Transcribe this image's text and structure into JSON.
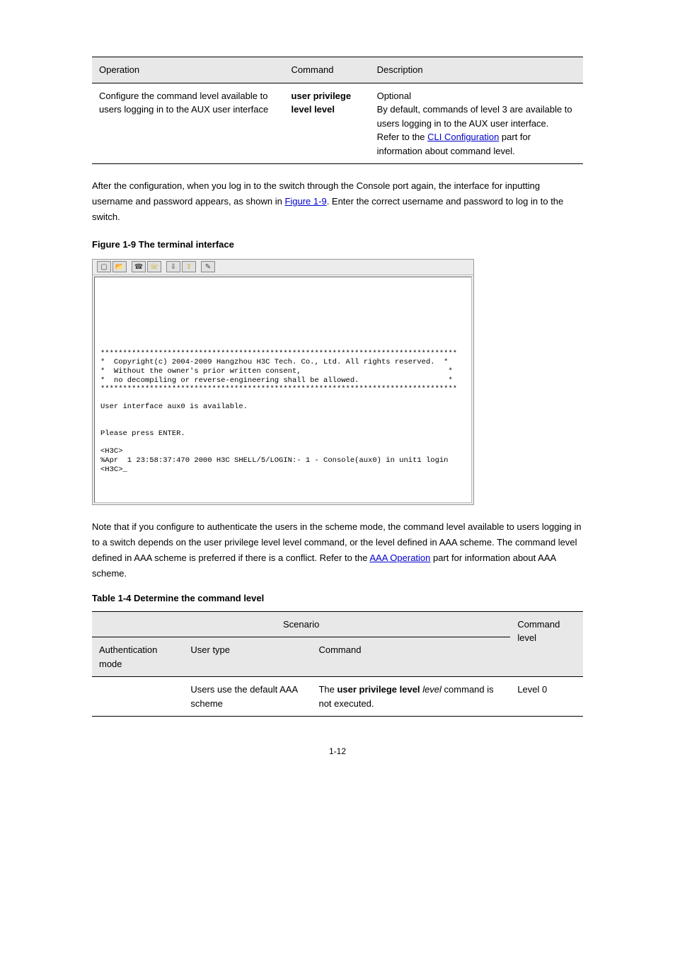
{
  "table4": {
    "headers": [
      "Operation",
      "Command",
      "Description"
    ],
    "rows": [
      {
        "operation": "Configure the command level available to users logging in to the AUX user interface",
        "command": "user privilege level level",
        "desc_prefix": "Optional\nBy default, commands of level 3 are available to users logging in to the AUX user interface.\nRefer to the ",
        "desc_link": "CLI Configuration",
        "desc_suffix": " part for information about command level."
      }
    ]
  },
  "para1_prefix": "After the configuration, when you log in to the switch through the Console port again, the interface for inputting username and password appears, as shown in ",
  "para1_link": "Figure 1-9",
  "para1_suffix": ". Enter the correct username and password to log in to the switch.",
  "fig_caption": "Figure 1-9 The terminal interface",
  "terminal": {
    "line_border": "********************************************************************************",
    "l1": "*  Copyright(c) 2004-2009 Hangzhou H3C Tech. Co., Ltd. All rights reserved.  *",
    "l2": "*  Without the owner's prior written consent,                                 *",
    "l3": "*  no decompiling or reverse-engineering shall be allowed.                    *",
    "blank": "",
    "avail": "User interface aux0 is available.",
    "enter": "Please press ENTER.",
    "p1": "<H3C>",
    "log": "%Apr  1 23:58:37:470 2000 H3C SHELL/5/LOGIN:- 1 - Console(aux0) in unit1 login",
    "p2": "<H3C>_"
  },
  "para2": "Note that if you configure to authenticate the users in the scheme mode, the command level available to users logging in to a switch depends on the user privilege level level command, or the level defined in AAA scheme. The command level defined in AAA scheme is preferred if there is a conflict. ",
  "para2_link_prefix": "Refer to the ",
  "para2_link": "AAA Operation",
  "para2_link_suffix": " part for information about AAA scheme.",
  "table5_caption": "Table 1-4 Determine the command level",
  "table5": {
    "headers": [
      "Scenario",
      "",
      "Command level"
    ],
    "subheaders": [
      "Authentication mode",
      "User type",
      "Command"
    ],
    "rows": [
      {
        "a": "",
        "b": "Users use the default AAA scheme",
        "c": "The user privilege level level command is not executed.",
        "d": "Level 0"
      }
    ]
  },
  "page_number": "1-12"
}
